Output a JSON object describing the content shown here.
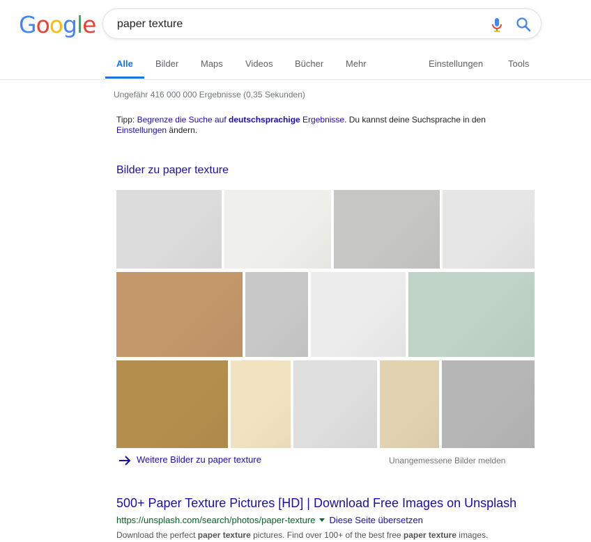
{
  "logo": {
    "letters": [
      "G",
      "o",
      "o",
      "g",
      "l",
      "e"
    ],
    "colors": [
      "#4285F4",
      "#EA4335",
      "#FBBC05",
      "#4285F4",
      "#34A853",
      "#EA4335"
    ]
  },
  "search": {
    "value": "paper texture"
  },
  "tabs": [
    {
      "label": "Alle",
      "active": true
    },
    {
      "label": "Bilder"
    },
    {
      "label": "Maps"
    },
    {
      "label": "Videos"
    },
    {
      "label": "Bücher"
    },
    {
      "label": "Mehr"
    },
    {
      "label": "Einstellungen"
    },
    {
      "label": "Tools"
    }
  ],
  "stats": "Ungefähr 416 000 000 Ergebnisse (0,35 Sekunden)",
  "tipp": {
    "prefix": "Tipp: ",
    "link1": "Begrenze die Suche auf ",
    "link_bold": "deutschsprachige",
    "link2": " Ergebnisse",
    "middle": ". Du kannst deine Suchsprache in den ",
    "link3": "Einstellungen",
    "suffix": " ändern."
  },
  "images": {
    "heading": "Bilder zu paper texture",
    "thumb_colors": [
      "#dcdcdc",
      "#efefec",
      "#c6c6c4",
      "#e6e6e6",
      "#c4976a",
      "#c8c8c8",
      "#ececec",
      "#bfd3c6",
      "#b48e4c",
      "#f2e3c0",
      "#dedede",
      "#e2d3b0",
      "#b6b6b6"
    ],
    "more_label": "Weitere Bilder zu paper texture",
    "report_label": "Unangemessene Bilder melden"
  },
  "result": {
    "title": "500+ Paper Texture Pictures [HD] | Download Free Images on Unsplash",
    "url": "https://unsplash.com/search/photos/paper-texture",
    "translate": "Diese Seite übersetzen",
    "snippet_parts": [
      "Download the perfect ",
      "paper texture",
      " pictures. Find over 100+ of the best free ",
      "paper texture",
      " images."
    ]
  }
}
